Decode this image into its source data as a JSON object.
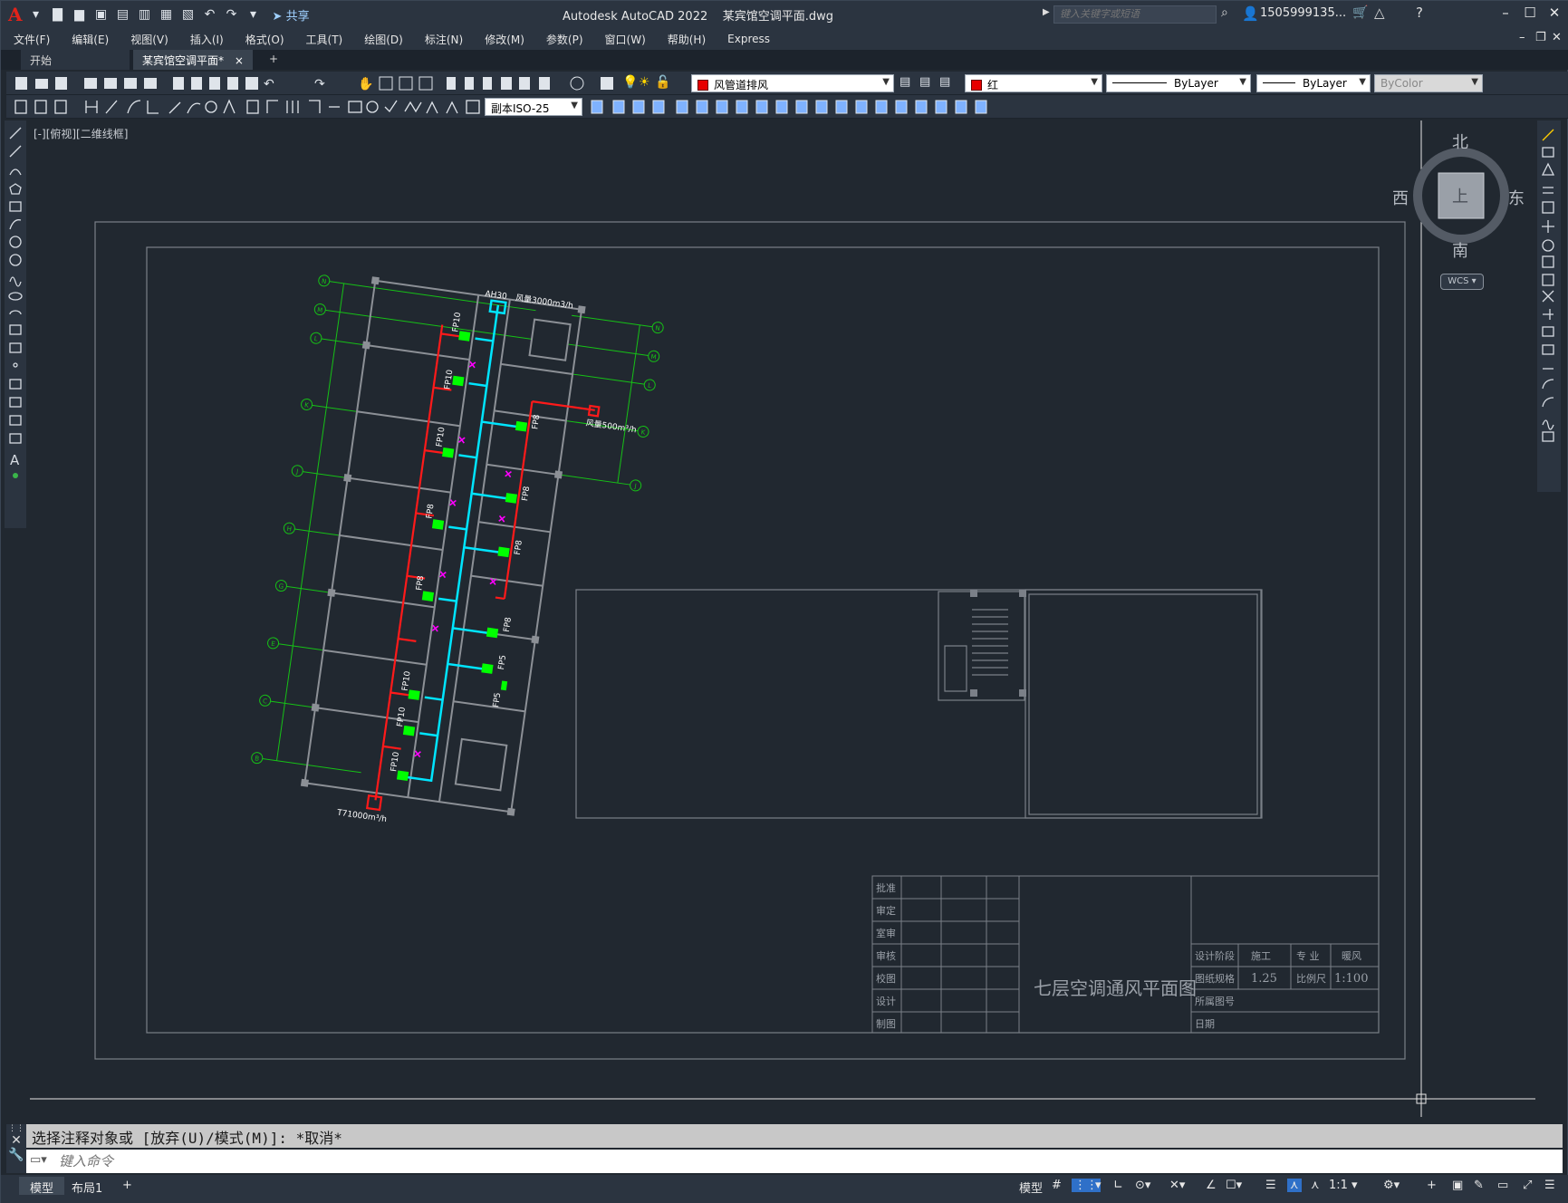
{
  "titlebar": {
    "app_name": "Autodesk AutoCAD 2022",
    "document": "某宾馆空调平面.dwg",
    "share_label": "共享",
    "search_placeholder": "键入关键字或短语",
    "user": "1505999135..."
  },
  "menu": {
    "items": [
      "文件(F)",
      "编辑(E)",
      "视图(V)",
      "插入(I)",
      "格式(O)",
      "工具(T)",
      "绘图(D)",
      "标注(N)",
      "修改(M)",
      "参数(P)",
      "窗口(W)",
      "帮助(H)",
      "Express"
    ]
  },
  "doc_tabs": {
    "start": "开始",
    "active": "某宾馆空调平面*",
    "close": "×",
    "add": "+"
  },
  "toolbar": {
    "layer": "风管道排风",
    "color": "红",
    "linetype": "ByLayer",
    "lineweight": "ByLayer",
    "plotstyle": "ByColor",
    "dimstyle": "副本ISO-25"
  },
  "viewport": {
    "label": "[-][俯视][二维线框]"
  },
  "viewcube": {
    "north": "北",
    "south": "南",
    "east": "东",
    "west": "西",
    "face": "上",
    "wcs": "WCS"
  },
  "drawing": {
    "ahu_label": "AH30",
    "ahu_airflow": "风量3000m3/h",
    "exhaust_airflow": "风量500m³/h",
    "fresh_airflow": "T71000m³/h",
    "unit_labels": [
      "FP10",
      "FP10",
      "FP10",
      "FP8",
      "FP8",
      "FP8",
      "FP8",
      "FP8",
      "FP8",
      "FP5",
      "FP5",
      "FP10",
      "FP10",
      "FP10"
    ],
    "grid_right": [
      "N",
      "M",
      "L",
      "K",
      "J"
    ],
    "grid_left": [
      "N",
      "M",
      "L",
      "K",
      "J",
      "H",
      "G",
      "E",
      "C",
      "B"
    ],
    "titleblock": {
      "sign_labels": [
        "批准",
        "审定",
        "室审",
        "审核",
        "校图",
        "设计",
        "制图"
      ],
      "drawing_title": "七层空调通风平面图",
      "stage_label": "设计阶段",
      "stage_value": "施工",
      "discipline_label": "专 业",
      "discipline_value": "暖风",
      "sheet_size_label": "图纸规格",
      "sheet_size_value": "1.25",
      "scale_label": "比例尺",
      "scale_value": "1:100",
      "ref_label": "所属图号",
      "date_label": "日期"
    }
  },
  "command": {
    "history": "选择注释对象或 [放弃(U)/模式(M)]: *取消*",
    "placeholder": "键入命令"
  },
  "status": {
    "model_tab": "模型",
    "layout_tab": "布局1",
    "add": "+",
    "model_space": "模型",
    "scale": "1:1"
  },
  "colors": {
    "supply_duct": "#00e5ff",
    "exhaust_duct": "#ff1a1a",
    "fan_coil": "#00ff00",
    "grid_lines": "#16c216",
    "walls": "#8c9096",
    "diffuser": "#ff00ff"
  }
}
